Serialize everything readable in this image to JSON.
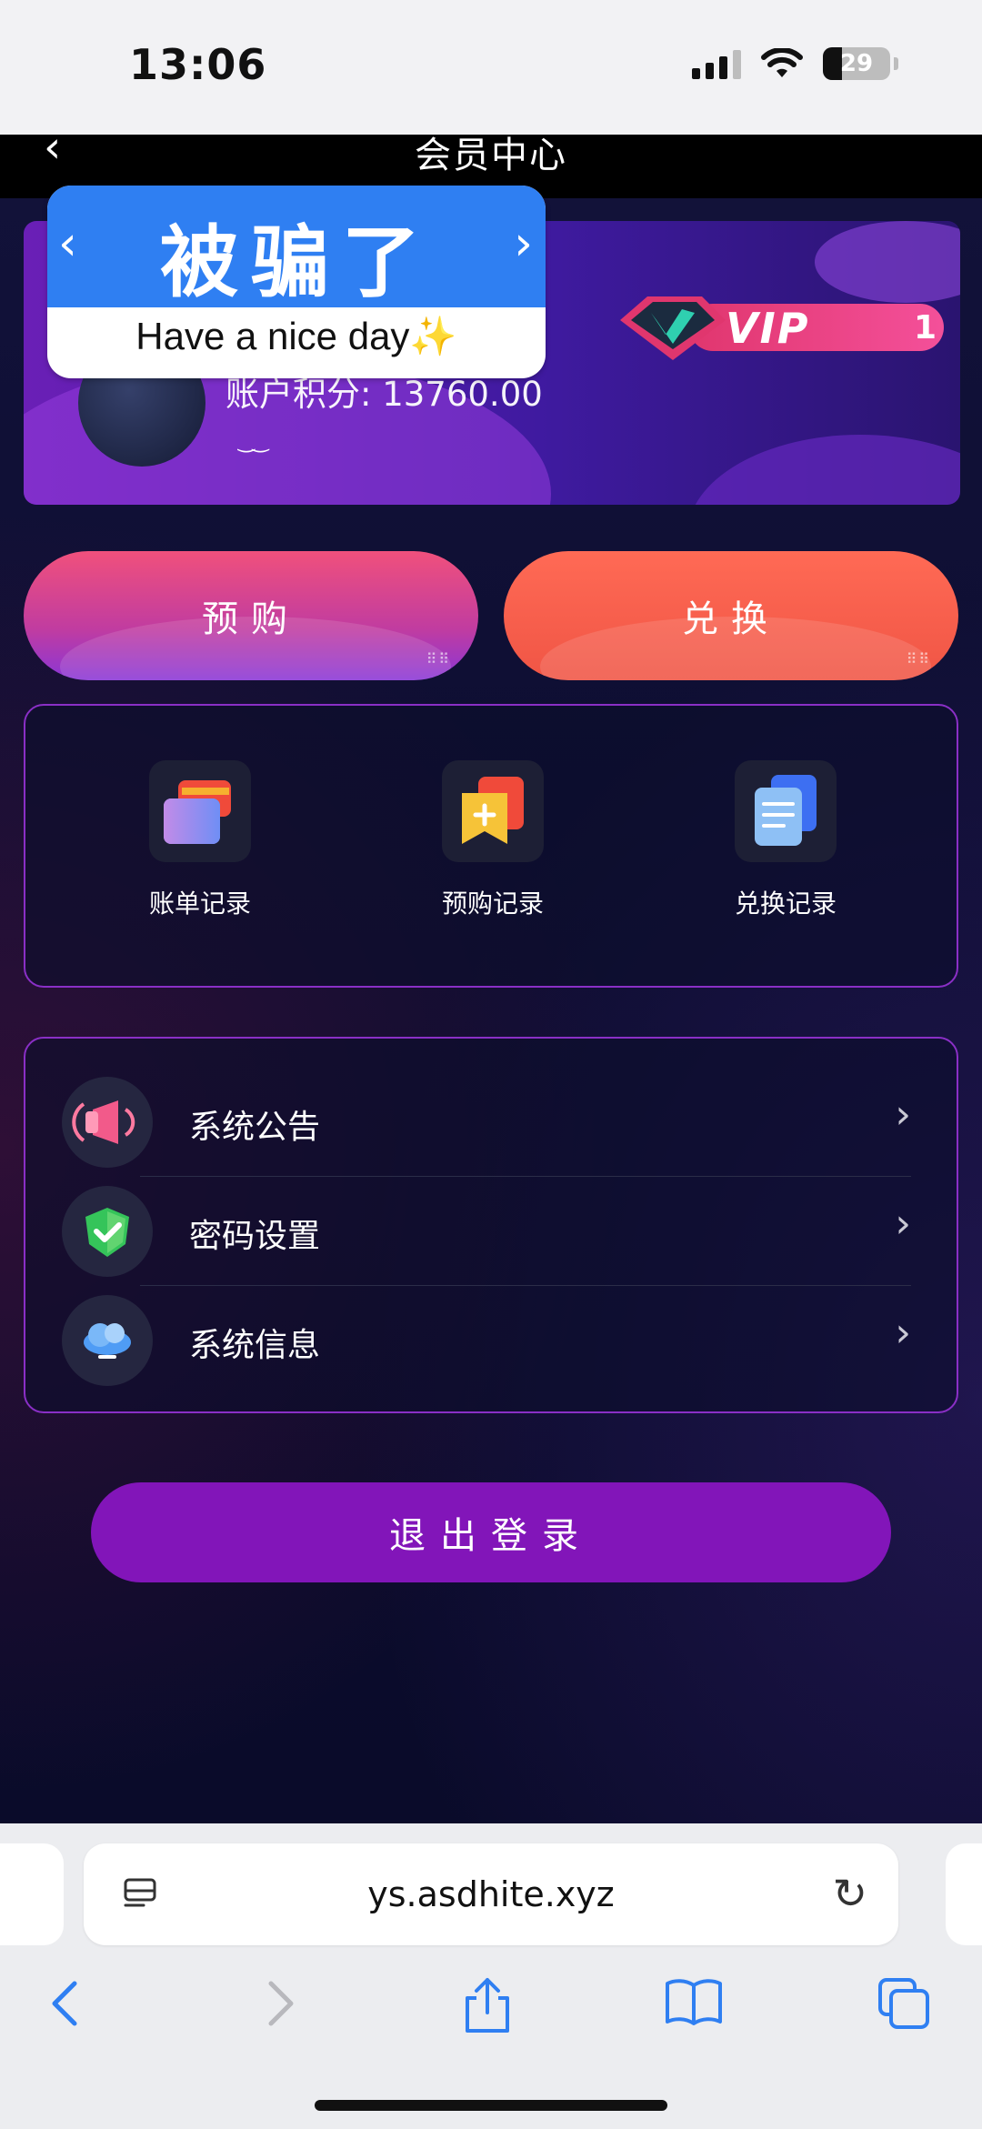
{
  "status_bar": {
    "time": "13:06",
    "battery": "29"
  },
  "nav": {
    "title": "会员中心"
  },
  "sticker": {
    "title": "被骗了",
    "subtitle": "Have a nice day✨"
  },
  "member": {
    "points": "账户积分: 13760.00",
    "vip_label": "VIP",
    "vip_level": "1"
  },
  "actions": {
    "preorder": "预购",
    "exchange": "兑换"
  },
  "records": [
    {
      "label": "账单记录",
      "icon": "cards-icon"
    },
    {
      "label": "预购记录",
      "icon": "add-bookmark-icon"
    },
    {
      "label": "兑换记录",
      "icon": "documents-icon"
    }
  ],
  "menu": [
    {
      "label": "系统公告",
      "icon": "megaphone-icon"
    },
    {
      "label": "密码设置",
      "icon": "shield-check-icon"
    },
    {
      "label": "系统信息",
      "icon": "cloud-icon"
    }
  ],
  "logout": "退出登录",
  "browser": {
    "url": "ys.asdhite.xyz"
  }
}
